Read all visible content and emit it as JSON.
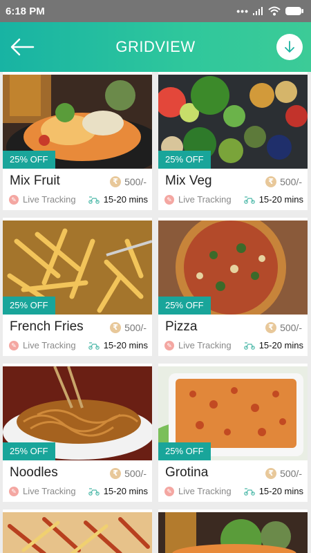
{
  "status": {
    "time": "6:18 PM"
  },
  "header": {
    "title": "GRIDVIEW"
  },
  "items": [
    {
      "name": "Mix Fruit",
      "discount": "25% OFF",
      "price": "500/-",
      "tracking": "Live Tracking",
      "eta": "15-20 mins"
    },
    {
      "name": "Mix Veg",
      "discount": "25% OFF",
      "price": "500/-",
      "tracking": "Live Tracking",
      "eta": "15-20 mins"
    },
    {
      "name": "French Fries",
      "discount": "25% OFF",
      "price": "500/-",
      "tracking": "Live Tracking",
      "eta": "15-20 mins"
    },
    {
      "name": "Pizza",
      "discount": "25% OFF",
      "price": "500/-",
      "tracking": "Live Tracking",
      "eta": "15-20 mins"
    },
    {
      "name": "Noodles",
      "discount": "25% OFF",
      "price": "500/-",
      "tracking": "Live Tracking",
      "eta": "15-20 mins"
    },
    {
      "name": "Grotina",
      "discount": "25% OFF",
      "price": "500/-",
      "tracking": "Live Tracking",
      "eta": "15-20 mins"
    }
  ],
  "icons": {
    "back": "arrow-left-icon",
    "download": "download-icon",
    "rupee": "rupee-icon",
    "pin": "location-pin-icon",
    "delivery": "delivery-scooter-icon"
  },
  "colors": {
    "accent": "#19a59a",
    "appbar_start": "#18b3a3",
    "appbar_end": "#3ccb97",
    "statusbar": "#757575"
  }
}
